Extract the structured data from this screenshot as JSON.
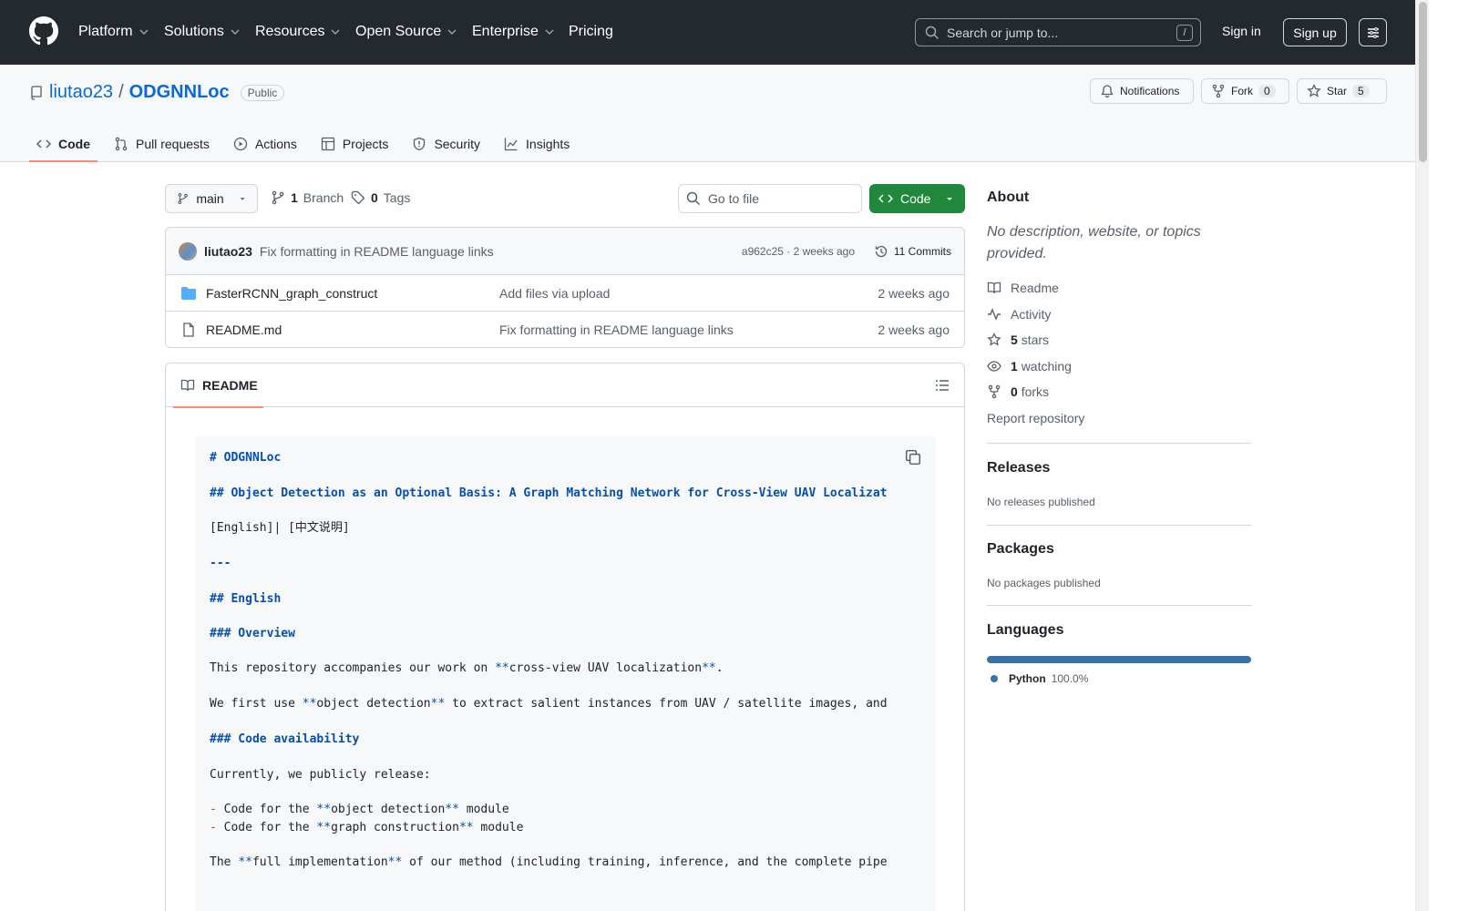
{
  "header": {
    "nav": [
      "Platform",
      "Solutions",
      "Resources",
      "Open Source",
      "Enterprise",
      "Pricing"
    ],
    "search_placeholder": "Search or jump to...",
    "slash_key": "/",
    "sign_in": "Sign in",
    "sign_up": "Sign up"
  },
  "repo": {
    "owner": "liutao23",
    "separator": "/",
    "name": "ODGNNLoc",
    "visibility": "Public",
    "notifications_label": "Notifications",
    "fork_label": "Fork",
    "fork_count": "0",
    "star_label": "Star",
    "star_count": "5",
    "tabs": [
      "Code",
      "Pull requests",
      "Actions",
      "Projects",
      "Security",
      "Insights"
    ]
  },
  "toolbar": {
    "branch": "main",
    "branch_count": "1",
    "branch_label": "Branch",
    "tag_count": "0",
    "tag_label": "Tags",
    "goto_placeholder": "Go to file",
    "code_label": "Code"
  },
  "latest_commit": {
    "author": "liutao23",
    "message": "Fix formatting in README language links",
    "hash_time": "a962c25 · 2 weeks ago",
    "commits": "11 Commits"
  },
  "files": [
    {
      "type": "folder",
      "name": "FasterRCNN_graph_construct",
      "message": "Add files via upload",
      "date": "2 weeks ago"
    },
    {
      "type": "file",
      "name": "README.md",
      "message": "Fix formatting in README language links",
      "date": "2 weeks ago"
    }
  ],
  "readme": {
    "tab_label": "README",
    "lines": {
      "l1": "# ODGNNLoc",
      "l2": "## Object Detection as an Optional Basis: A Graph Matching Network for Cross-View UAV Localizat",
      "l3": "[English]| [中文说明]",
      "l4": "---",
      "l5": "## English",
      "l6": "### Overview",
      "l7a": "This repository accompanies our work on ",
      "l7b": "**",
      "l7c": "cross-view UAV localization",
      "l7d": "**",
      "l7e": ".",
      "l8a": "We first use ",
      "l8b": "**",
      "l8c": "object detection",
      "l8d": "**",
      "l8e": " to extract salient instances from UAV / satellite images, and",
      "l9": "### Code availability",
      "l10": "Currently, we publicly release:",
      "l11a": "- ",
      "l11b": "Code for the ",
      "l11c": "**",
      "l11d": "object detection",
      "l11e": "**",
      "l11f": " module",
      "l12a": "- ",
      "l12b": "Code for the ",
      "l12c": "**",
      "l12d": "graph construction",
      "l12e": "**",
      "l12f": " module",
      "l13a": "The ",
      "l13b": "**",
      "l13c": "full implementation",
      "l13d": "**",
      "l13e": " of our method (including training, inference, and the complete pipe"
    }
  },
  "sidebar": {
    "about_title": "About",
    "about_desc": "No description, website, or topics provided.",
    "readme": "Readme",
    "activity": "Activity",
    "stars_count": "5",
    "stars_label": "stars",
    "watching_count": "1",
    "watching_label": "watching",
    "forks_count": "0",
    "forks_label": "forks",
    "report": "Report repository",
    "releases_title": "Releases",
    "releases_empty": "No releases published",
    "packages_title": "Packages",
    "packages_empty": "No packages published",
    "languages_title": "Languages",
    "languages": [
      {
        "name": "Python",
        "percent": "100.0%",
        "color": "#3572A5"
      }
    ]
  }
}
